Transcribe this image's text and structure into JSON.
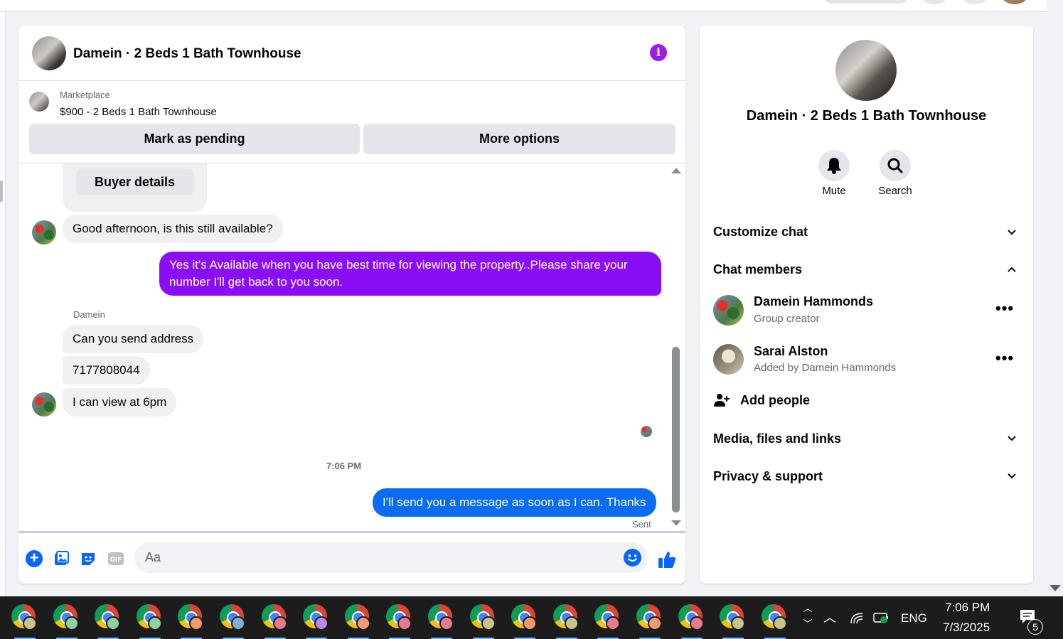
{
  "conversation": {
    "title": "Damein · 2 Beds 1 Bath Townhouse",
    "listing_source": "Marketplace",
    "listing_title": "$900 - 2 Beds 1 Bath Townhouse",
    "mark_pending_label": "Mark as pending",
    "more_options_label": "More options",
    "buyer_details_label": "Buyer details",
    "messages": [
      {
        "from": "buyer",
        "text": "Good afternoon, is this still available?"
      },
      {
        "from": "me",
        "text_line1": "Yes it's Available when you have best time for viewing the property..Please share your",
        "text_line2": "number I'll get back to you soon."
      },
      {
        "sender_name": "Damein"
      },
      {
        "from": "buyer",
        "text": "Can you send address"
      },
      {
        "from": "buyer",
        "text": "7177808044"
      },
      {
        "from": "buyer",
        "text": "I can view at 6pm"
      },
      {
        "timestamp": "7:06 PM"
      },
      {
        "from": "me",
        "text": "I'll send you a message as soon as I can. Thanks"
      }
    ],
    "status": "Sent",
    "composer_placeholder": "Aa"
  },
  "info_panel": {
    "name": "Damein · 2 Beds 1 Bath Townhouse",
    "mute_label": "Mute",
    "search_label": "Search",
    "customize_chat": "Customize chat",
    "chat_members": "Chat members",
    "members": [
      {
        "name": "Damein Hammonds",
        "role": "Group creator"
      },
      {
        "name": "Sarai Alston",
        "role": "Added by Damein Hammonds"
      }
    ],
    "add_people": "Add people",
    "media_files_links": "Media, files and links",
    "privacy_support": "Privacy & support"
  },
  "taskbar": {
    "language": "ENG",
    "time": "7:06 PM",
    "date": "7/3/2025",
    "notification_count": "5",
    "app_count": 19,
    "profile_badge_colors": [
      "#c8c38a",
      "#8fd19e",
      "#8fd19e",
      "#8fd19e",
      "#f29a6b",
      "#7fb0d6",
      "#e87a8f",
      "#b58ce0",
      "#f29a6b",
      "#e87a8f",
      "#e87a8f",
      "#c8c38a",
      "#f29a6b",
      "#c8c38a",
      "#e87a8f",
      "#f29a6b",
      "#e87a8f",
      "#c8c38a",
      "#c8c38a"
    ]
  },
  "colors": {
    "accent_purple": "#8a0ef5",
    "accent_blue": "#0a6cf0",
    "messenger_blue": "#0866ff"
  }
}
